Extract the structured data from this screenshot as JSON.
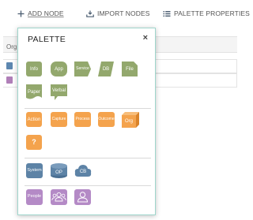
{
  "toolbar": {
    "add_node_label": "ADD NODE",
    "import_nodes_label": "IMPORT NODES",
    "palette_properties_label": "PALETTE PROPERTIES"
  },
  "background": {
    "header_label": "Org",
    "chip_colors": [
      "#5d87b0",
      "#b07fb8"
    ]
  },
  "palette": {
    "title": "PALETTE",
    "close_glyph": "×",
    "sections": [
      {
        "color": "#93a86d",
        "items": [
          "Info",
          "App",
          "Service",
          "DB",
          "File",
          "Paper",
          "Verbal"
        ]
      },
      {
        "color": "#f4a34d",
        "items": [
          "Action",
          "Capture",
          "Process",
          "Outcome",
          "Org",
          "?"
        ]
      },
      {
        "color": "#5d83a6",
        "items": [
          "System",
          "OP",
          "CB"
        ]
      },
      {
        "color": "#b48ac6",
        "items": [
          "People",
          "group-icon",
          "user-icon"
        ]
      }
    ]
  }
}
